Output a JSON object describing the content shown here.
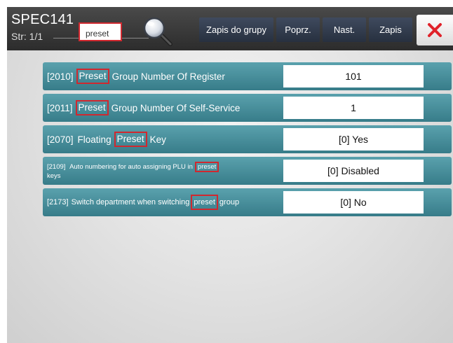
{
  "header": {
    "title": "SPEC141",
    "page_info": "Str: 1/1",
    "search_value": "preset",
    "buttons": {
      "save_to_group": "Zapis do grupy",
      "previous": "Poprz.",
      "next": "Nast.",
      "save": "Zapis"
    }
  },
  "settings": [
    {
      "code": "[2010]",
      "before": "",
      "highlight": "Preset",
      "after": "Group Number Of Register",
      "value": "101"
    },
    {
      "code": "[2011]",
      "before": "",
      "highlight": "Preset",
      "after": "Group Number Of Self-Service",
      "value": "1"
    },
    {
      "code": "[2070]",
      "before": "Floating",
      "highlight": "Preset",
      "after": "Key",
      "value": "[0]  Yes"
    },
    {
      "code": "[2109]",
      "before": "Auto numbering for auto assigning PLU in",
      "highlight": "preset",
      "after": "keys",
      "value": "[0]  Disabled"
    },
    {
      "code": "[2173]",
      "before": "Switch department when switching",
      "highlight": "preset",
      "after": "group",
      "value": "[0]  No"
    }
  ],
  "colors": {
    "row_teal": "#4a929f",
    "highlight_border": "#d0282f",
    "close_x": "#e0222a",
    "button_navy": "#2f3a4e"
  }
}
